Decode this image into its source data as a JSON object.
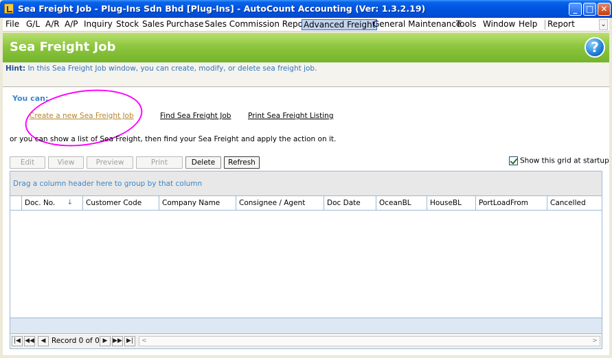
{
  "window": {
    "title": "Sea Freight Job - Plug-Ins Sdn Bhd [Plug-Ins] - AutoCount Accounting (Ver: 1.3.2.19)",
    "controls": {
      "minimize": "_",
      "maximize": "□",
      "close": "✕"
    }
  },
  "menu": {
    "items": [
      "File",
      "G/L",
      "A/R",
      "A/P",
      "Inquiry",
      "Stock",
      "Sales",
      "Purchase",
      "Sales Commission Report",
      "Advanced Freight",
      "General Maintenance",
      "Tools",
      "Window",
      "Help",
      "Report"
    ],
    "active": "Advanced Freight",
    "overflow_glyph": "⌄"
  },
  "header": {
    "title": "Sea Freight Job",
    "help_glyph": "?"
  },
  "hint": {
    "label": "Hint:",
    "text": "In this Sea Freight Job window, you can create, modify, or delete sea freight job."
  },
  "actions": {
    "you_can": "You can:",
    "create_link": "Create a new Sea Freight Job",
    "find_link": "Find Sea Freight Job",
    "print_link": "Print Sea Freight Listing",
    "or_text": "or you can show a list of Sea Freight, then find your Sea Freight and apply the action on it."
  },
  "toolbar": {
    "buttons": [
      {
        "label": "Edit",
        "enabled": false
      },
      {
        "label": "View",
        "enabled": false
      },
      {
        "label": "Preview",
        "enabled": false
      },
      {
        "label": "Print",
        "enabled": false
      },
      {
        "label": "Delete",
        "enabled": true
      },
      {
        "label": "Refresh",
        "enabled": true
      }
    ],
    "show_grid_label": "Show this grid at startup",
    "show_grid_checked": true
  },
  "grid": {
    "group_hint": "Drag a column header here to group by that column",
    "columns": [
      "Doc. No.",
      "Customer Code",
      "Company Name",
      "Consignee / Agent",
      "Doc Date",
      "OceanBL",
      "HouseBL",
      "PortLoadFrom",
      "Cancelled"
    ],
    "sort_glyph": "↓",
    "rows": [],
    "navigator": {
      "record_text": "Record 0 of 0",
      "first": "|◀",
      "prev_page": "◀◀",
      "prev": "◀",
      "next": "▶",
      "next_page": "▶▶",
      "last": "▶|",
      "scroll_left": "<",
      "scroll_right": ">"
    }
  },
  "annotation": {
    "highlight_color": "#ff00ff"
  },
  "colors": {
    "title_bar": "#0054e3",
    "header_green": "#8ec63f",
    "hint_blue": "#3375b8",
    "link_create": "#b5852b"
  }
}
